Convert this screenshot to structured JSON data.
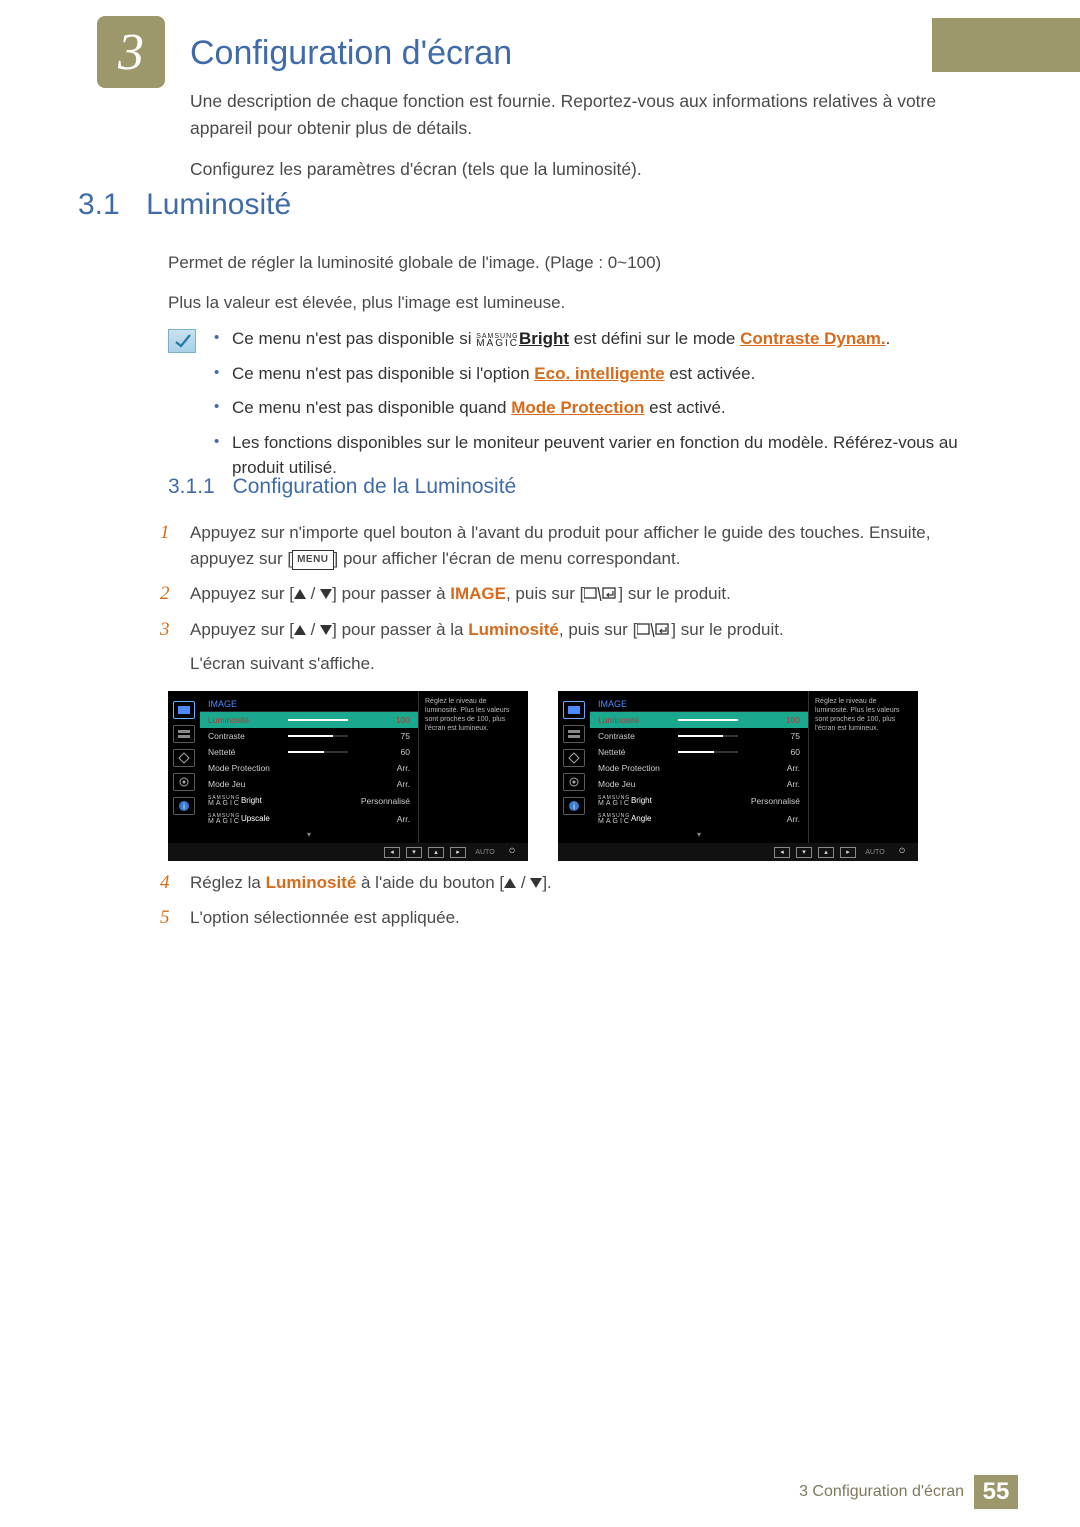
{
  "chapter": {
    "number": "3",
    "title": "Configuration d'écran"
  },
  "intro": {
    "p1": "Une description de chaque fonction est fournie. Reportez-vous aux informations relatives à votre appareil pour obtenir plus de détails.",
    "p2": "Configurez les paramètres d'écran (tels que la luminosité)."
  },
  "section": {
    "num": "3.1",
    "title": "Luminosité",
    "p1": "Permet de régler la luminosité globale de l'image. (Plage : 0~100)",
    "p2": "Plus la valeur est élevée, plus l'image est lumineuse."
  },
  "notes": {
    "n1_a": "Ce menu n'est pas disponible si ",
    "n1_bright": "Bright",
    "n1_b": " est défini sur le mode ",
    "n1_link": "Contraste Dynam.",
    "n1_c": ".",
    "n2_a": "Ce menu n'est pas disponible si l'option ",
    "n2_link": "Eco. intelligente",
    "n2_b": " est activée.",
    "n3_a": "Ce menu n'est pas disponible quand ",
    "n3_link": "Mode Protection",
    "n3_b": " est activé.",
    "n4": "Les fonctions disponibles sur le moniteur peuvent varier en fonction du modèle. Référez-vous au produit utilisé."
  },
  "subsection": {
    "num": "3.1.1",
    "title": "Configuration de la Luminosité"
  },
  "magic_top": "SAMSUNG",
  "magic_bot": "MAGIC",
  "steps": {
    "s1_a": "Appuyez sur n'importe quel bouton à l'avant du produit pour afficher le guide des touches. Ensuite, appuyez sur [",
    "s1_menu": "MENU",
    "s1_b": "] pour afficher l'écran de menu correspondant.",
    "s2_a": "Appuyez sur [",
    "s2_b": "] pour passer à ",
    "s2_image": "IMAGE",
    "s2_c": ", puis sur [",
    "s2_d": "] sur le produit.",
    "s3_a": "Appuyez sur [",
    "s3_b": "] pour passer à la ",
    "s3_lum": "Luminosité",
    "s3_c": ", puis sur [",
    "s3_d": "] sur le produit.",
    "s3_e": "L'écran suivant s'affiche.",
    "s4_a": "Réglez la ",
    "s4_lum": "Luminosité",
    "s4_b": " à l'aide du bouton [",
    "s4_c": "].",
    "s5": "L'option sélectionnée est appliquée."
  },
  "osd": {
    "title": "IMAGE",
    "hint": "Réglez le niveau de luminosité. Plus les valeurs sont proches de 100, plus l'écran est lumineux.",
    "bbar_auto": "AUTO",
    "panel1": [
      {
        "label": "Luminosité",
        "value": "100",
        "bar": 100,
        "hi": true
      },
      {
        "label": "Contraste",
        "value": "75",
        "bar": 75
      },
      {
        "label": "Netteté",
        "value": "60",
        "bar": 60
      },
      {
        "label": "Mode Protection",
        "value": "Arr."
      },
      {
        "label": "Mode Jeu",
        "value": "Arr."
      },
      {
        "label": "MAGICBright",
        "value": "Personnalisé",
        "magic": true
      },
      {
        "label": "MAGICUpscale",
        "value": "Arr.",
        "magic": true
      }
    ],
    "panel2": [
      {
        "label": "Luminosité",
        "value": "100",
        "bar": 100,
        "hi": true
      },
      {
        "label": "Contraste",
        "value": "75",
        "bar": 75
      },
      {
        "label": "Netteté",
        "value": "60",
        "bar": 60
      },
      {
        "label": "Mode Protection",
        "value": "Arr."
      },
      {
        "label": "Mode Jeu",
        "value": "Arr."
      },
      {
        "label": "MAGICBright",
        "value": "Personnalisé",
        "magic": true
      },
      {
        "label": "MAGICAngle",
        "value": "Arr.",
        "magic": true
      }
    ]
  },
  "footer": {
    "text": "3 Configuration d'écran",
    "page": "55"
  }
}
